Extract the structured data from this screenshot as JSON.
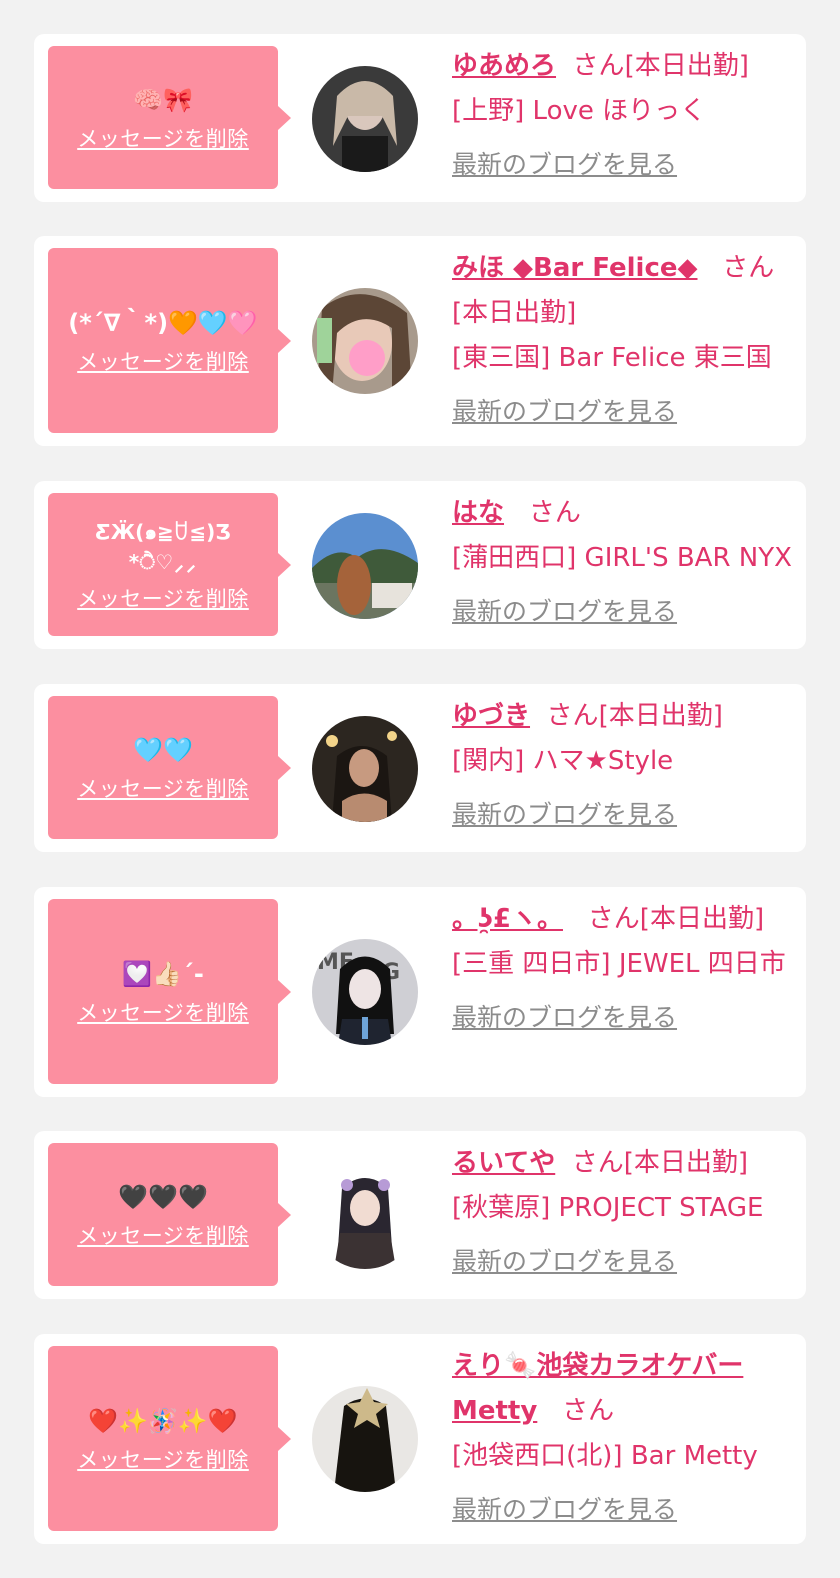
{
  "delete_label": "メッセージを削除",
  "blog_label": "最新のブログを見る",
  "honorific": "さん",
  "cards": [
    {
      "message": "🧠🎀",
      "name": "ゆあめろ",
      "status": "[本日出勤]",
      "shop": "[上野] Love ほりっく"
    },
    {
      "message": "(*´∇｀*)🧡🩵🩷",
      "name": "みほ ◆Bar Felice◆",
      "status": "[本日出勤]",
      "shop": "[東三国] Bar Felice 東三国"
    },
    {
      "message": "ƸӜ(๑≧ꇴ≦)Ʒ\n*ੈ♡⸝⸝",
      "name": "はな",
      "status": "",
      "shop": "[蒲田西口] GIRL'S BAR NYX"
    },
    {
      "message": "🩵🩵",
      "name": "ゆづき",
      "status": "[本日出勤]",
      "shop": "[関内] ハマ★Style"
    },
    {
      "message": "💟👍🏻´-",
      "name": "。ʖ̯£ヽ。",
      "status": "[本日出勤]",
      "shop": "[三重 四日市] JEWEL 四日市"
    },
    {
      "message": "🖤🖤🖤",
      "name": "るいてや",
      "status": "[本日出勤]",
      "shop": "[秋葉原] PROJECT STAGE"
    },
    {
      "message": "❤️✨🪅✨❤️",
      "name": "えり🍬池袋カラオケバーMetty",
      "status": "",
      "shop": "[池袋西口(北)] Bar Metty"
    }
  ],
  "colors": {
    "accent": "#e0346a",
    "bubble": "#fc8fa0",
    "link_gray": "#8c8c8c",
    "background": "#f2f2f2"
  }
}
